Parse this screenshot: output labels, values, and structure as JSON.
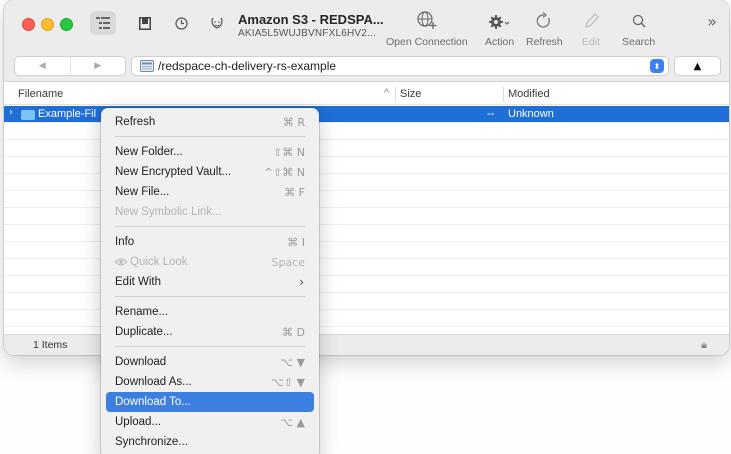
{
  "window": {
    "connection_title": "Amazon S3 - REDSPA...",
    "connection_subtitle": "AKIA5L5WUJBVNFXL6HV2..."
  },
  "toolbar": {
    "open_connection": "Open Connection",
    "action": "Action",
    "refresh": "Refresh",
    "edit": "Edit",
    "search": "Search",
    "overflow": "»"
  },
  "navigation": {
    "back": "◀",
    "forward": "▶",
    "path": "/redspace-ch-delivery-rs-example",
    "up": "▲"
  },
  "columns": {
    "filename": "Filename",
    "size": "Size",
    "modified": "Modified",
    "sort_indicator": "^"
  },
  "files": [
    {
      "name": "Example-Files",
      "name_visible": "Example-Fil",
      "size": "--",
      "modified": "Unknown"
    }
  ],
  "status": {
    "items": "1 Items"
  },
  "context_menu": {
    "refresh": {
      "label": "Refresh",
      "shortcut": "⌘ R"
    },
    "new_folder": {
      "label": "New Folder...",
      "shortcut": "⇧⌘ N"
    },
    "new_vault": {
      "label": "New Encrypted Vault...",
      "shortcut": "^⇧⌘ N"
    },
    "new_file": {
      "label": "New File...",
      "shortcut": "⌘ F"
    },
    "new_symlink": {
      "label": "New Symbolic Link...",
      "shortcut": ""
    },
    "info": {
      "label": "Info",
      "shortcut": "⌘ I"
    },
    "quick_look": {
      "label": "Quick Look",
      "shortcut": "Space"
    },
    "edit_with": {
      "label": "Edit With",
      "shortcut": "›"
    },
    "rename": {
      "label": "Rename...",
      "shortcut": ""
    },
    "duplicate": {
      "label": "Duplicate...",
      "shortcut": "⌘ D"
    },
    "download": {
      "label": "Download",
      "shortcut": "⌥ ▼"
    },
    "download_as": {
      "label": "Download As...",
      "shortcut": "⌥⇧ ▼"
    },
    "download_to": {
      "label": "Download To...",
      "shortcut": ""
    },
    "upload": {
      "label": "Upload...",
      "shortcut": "⌥ ▲"
    },
    "synchronize": {
      "label": "Synchronize...",
      "shortcut": ""
    }
  },
  "colors": {
    "selection": "#1f6fd6",
    "menu_highlight": "#3d7fe0",
    "folder": "#7fc4f6"
  }
}
